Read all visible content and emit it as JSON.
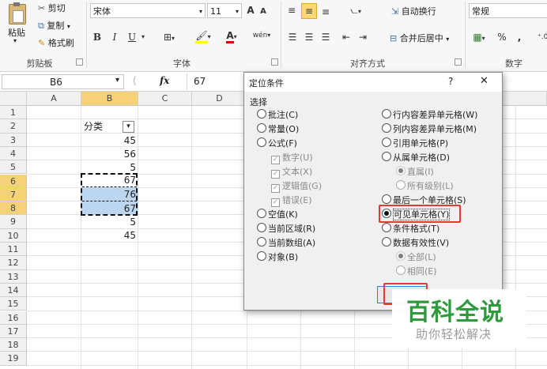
{
  "ribbon": {
    "clipboard": {
      "paste": "粘贴",
      "cut": "剪切",
      "copy": "复制",
      "format_painter": "格式刷",
      "group": "剪贴板"
    },
    "font": {
      "name": "宋体",
      "size": "11",
      "grow": "A",
      "shrink": "A",
      "bold": "B",
      "italic": "I",
      "underline": "U",
      "phonetic": "wén",
      "group": "字体"
    },
    "alignment": {
      "wrap": "自动换行",
      "merge": "合并后居中",
      "group": "对齐方式"
    },
    "number": {
      "format": "常规",
      "percent": "%",
      "comma": ",",
      "group": "数字"
    }
  },
  "formula_bar": {
    "name_box": "B6",
    "fx": "fx",
    "value": "67"
  },
  "grid": {
    "columns": [
      "A",
      "B",
      "C",
      "D"
    ],
    "rows": [
      "1",
      "2",
      "3",
      "4",
      "5",
      "6",
      "7",
      "8",
      "9",
      "10",
      "11",
      "12",
      "13",
      "14",
      "15",
      "16",
      "17",
      "18",
      "19"
    ],
    "b_header": "分类",
    "b_values": [
      "45",
      "56",
      "5",
      "67",
      "76",
      "67",
      "5",
      "45"
    ]
  },
  "dialog": {
    "title": "定位条件",
    "help": "?",
    "close": "✕",
    "section": "选择",
    "left": {
      "comments": "批注(C)",
      "constants": "常量(O)",
      "formulas": "公式(F)",
      "numbers": "数字(U)",
      "text": "文本(X)",
      "logicals": "逻辑值(G)",
      "errors": "错误(E)",
      "blanks": "空值(K)",
      "current_region": "当前区域(R)",
      "current_array": "当前数组(A)",
      "objects": "对象(B)"
    },
    "right": {
      "row_diff": "行内容差异单元格(W)",
      "col_diff": "列内容差异单元格(M)",
      "precedents": "引用单元格(P)",
      "dependents": "从属单元格(D)",
      "direct_only": "直属(I)",
      "all_levels": "所有级别(L)",
      "last_cell": "最后一个单元格(S)",
      "visible_cells": "可见单元格(Y)",
      "conditional": "条件格式(T)",
      "validation": "数据有效性(V)",
      "val_all": "全部(L)",
      "val_same": "相同(E)"
    }
  },
  "watermark": {
    "title": "百科全说",
    "subtitle": "助你轻松解决"
  },
  "colors": {
    "accent_red": "#e53935",
    "selection": "#bcd6f0",
    "column_b_header": "#f5d27a",
    "watermark_green": "#2e9a3e"
  }
}
